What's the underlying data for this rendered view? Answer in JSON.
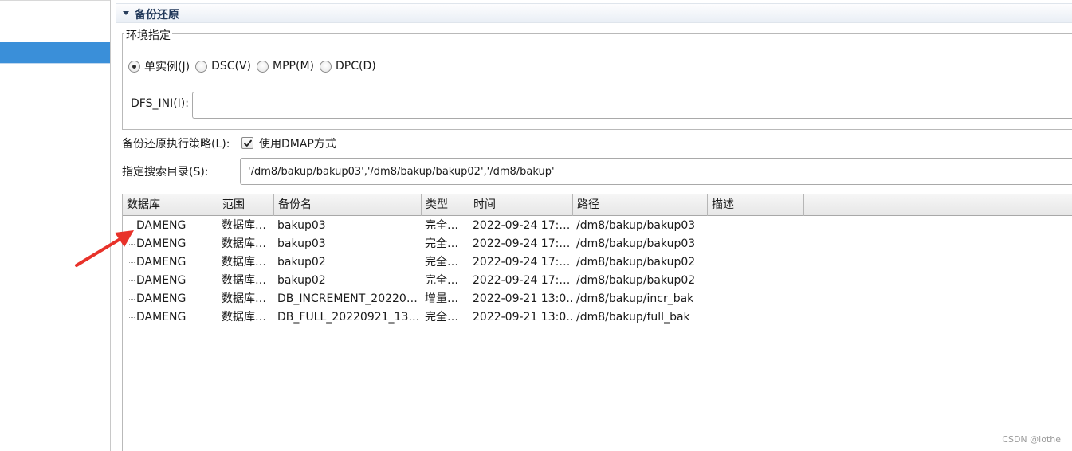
{
  "section": {
    "title": "备份还原"
  },
  "environment": {
    "group_title": "环境指定",
    "options": [
      {
        "label": "单实例(J)",
        "checked": true
      },
      {
        "label": "DSC(V)",
        "checked": false
      },
      {
        "label": "MPP(M)",
        "checked": false
      },
      {
        "label": "DPC(D)",
        "checked": false
      }
    ],
    "dfs_label": "DFS_INI(I):",
    "dfs_value": ""
  },
  "strategy": {
    "label": "备份还原执行策略(L):",
    "checkbox_label": "使用DMAP方式",
    "checked": true
  },
  "search": {
    "label": "指定搜索目录(S):",
    "value": "'/dm8/bakup/bakup03','/dm8/bakup/bakup02','/dm8/bakup'"
  },
  "table": {
    "columns": [
      "数据库",
      "范围",
      "备份名",
      "类型",
      "时间",
      "路径",
      "描述"
    ],
    "rows": [
      [
        "DAMENG",
        "数据库…",
        "bakup03",
        "完全…",
        "2022-09-24 17:…",
        "/dm8/bakup/bakup03",
        ""
      ],
      [
        "DAMENG",
        "数据库…",
        "bakup03",
        "完全…",
        "2022-09-24 17:…",
        "/dm8/bakup/bakup03",
        ""
      ],
      [
        "DAMENG",
        "数据库…",
        "bakup02",
        "完全…",
        "2022-09-24 17:…",
        "/dm8/bakup/bakup02",
        ""
      ],
      [
        "DAMENG",
        "数据库…",
        "bakup02",
        "完全…",
        "2022-09-24 17:…",
        "/dm8/bakup/bakup02",
        ""
      ],
      [
        "DAMENG",
        "数据库…",
        "DB_INCREMENT_20220…",
        "增量…",
        "2022-09-21 13:0…",
        "/dm8/bakup/incr_bak",
        ""
      ],
      [
        "DAMENG",
        "数据库…",
        "DB_FULL_20220921_13…",
        "完全…",
        "2022-09-21 13:0…",
        "/dm8/bakup/full_bak",
        ""
      ]
    ]
  },
  "annotation": {
    "arrow_color": "#e8322a"
  },
  "watermark": "CSDN @iothe"
}
